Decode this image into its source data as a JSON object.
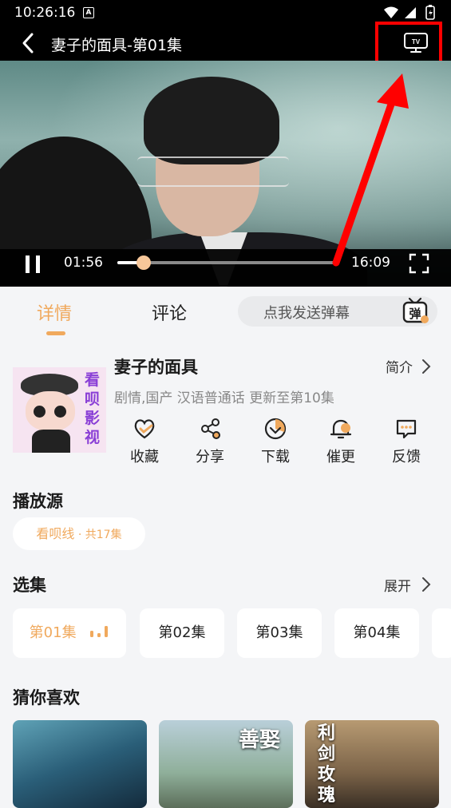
{
  "status_bar": {
    "time": "10:26:16",
    "a_badge": "A"
  },
  "header": {
    "title": "妻子的面具-第01集",
    "cast_label": "TV"
  },
  "player": {
    "current_time": "01:56",
    "duration": "16:09",
    "progress": 0.12
  },
  "tabs": [
    {
      "label": "详情",
      "active": true
    },
    {
      "label": "评论",
      "active": false
    }
  ],
  "danmaku": {
    "placeholder": "点我发送弹幕",
    "icon_text": "弹"
  },
  "show": {
    "poster_text": "看呗影视",
    "title": "妻子的面具",
    "meta": "剧情,国产 汉语普通话 更新至第10集",
    "intro_label": "简介"
  },
  "actions": [
    {
      "label": "收藏",
      "icon": "heart-check-icon"
    },
    {
      "label": "分享",
      "icon": "share-icon"
    },
    {
      "label": "下载",
      "icon": "download-icon"
    },
    {
      "label": "催更",
      "icon": "bell-icon"
    },
    {
      "label": "反馈",
      "icon": "feedback-icon"
    }
  ],
  "source": {
    "heading": "播放源",
    "chip_name": "看呗线",
    "chip_count": " · 共17集"
  },
  "episodes": {
    "heading": "选集",
    "expand_label": "展开",
    "items": [
      {
        "label": "第01集",
        "active": true
      },
      {
        "label": "第02集",
        "active": false
      },
      {
        "label": "第03集",
        "active": false
      },
      {
        "label": "第04集",
        "active": false
      }
    ]
  },
  "recommend": {
    "heading": "猜你喜欢",
    "items": [
      {
        "caption": ""
      },
      {
        "caption": "善娶"
      },
      {
        "caption": "利剑玫瑰"
      }
    ]
  },
  "colors": {
    "accent": "#f0a95d",
    "highlight_box": "#ff0000",
    "arrow": "#ff0000"
  }
}
